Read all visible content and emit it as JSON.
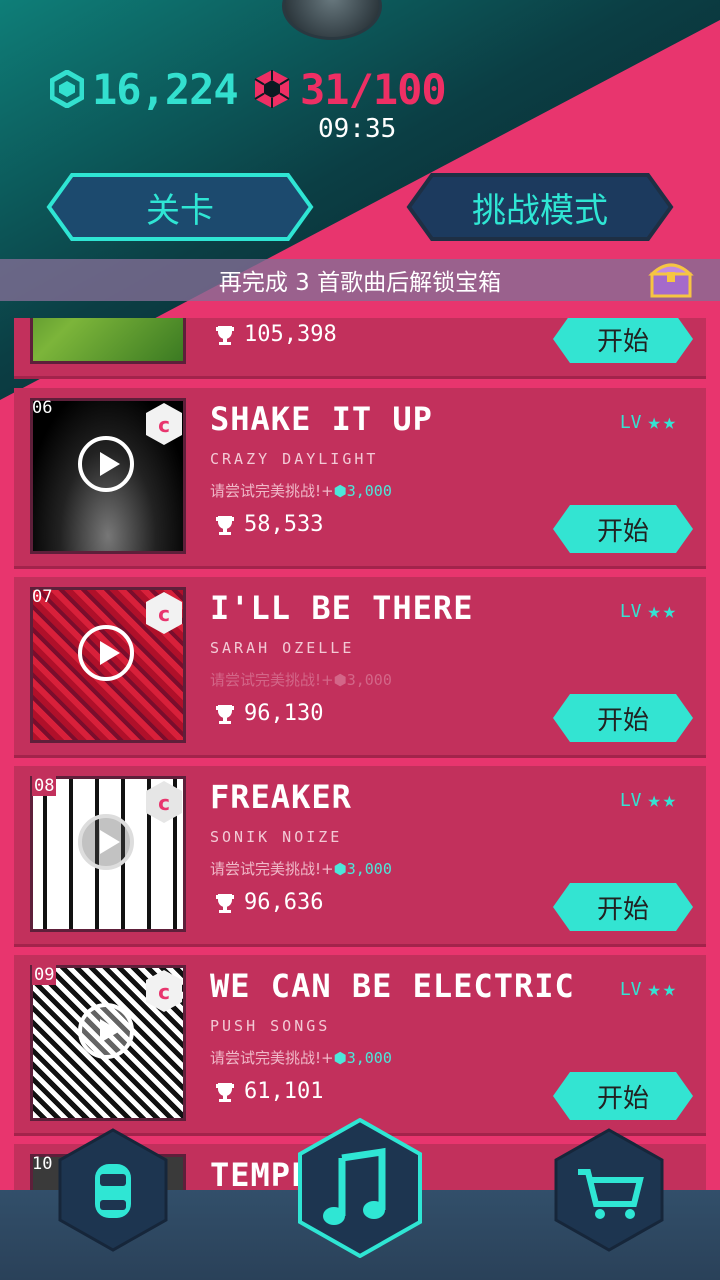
{
  "header": {
    "coins": "16,224",
    "energy": "31/100",
    "timer": "09:35"
  },
  "tabs": [
    {
      "label": "关卡"
    },
    {
      "label": "挑战模式"
    }
  ],
  "banner": "再完成 3 首歌曲后解锁宝箱",
  "songs": [
    {
      "number": "",
      "title": "",
      "artist": "",
      "hint": "",
      "reward": "",
      "score": "105,398",
      "level_label": "",
      "start_label": "开始"
    },
    {
      "number": "06",
      "title": "SHAKE IT UP",
      "artist": "CRAZY DAYLIGHT",
      "hint": "请尝试完美挑战!+",
      "reward": "3,000",
      "score": "58,533",
      "level_label": "LV",
      "start_label": "开始"
    },
    {
      "number": "07",
      "title": "I'LL BE THERE",
      "artist": "SARAH OZELLE",
      "hint": "请尝试完美挑战!+",
      "reward": "3,000",
      "score": "96,130",
      "level_label": "LV",
      "start_label": "开始"
    },
    {
      "number": "08",
      "title": "FREAKER",
      "artist": "SONIK NOIZE",
      "hint": "请尝试完美挑战!+",
      "reward": "3,000",
      "score": "96,636",
      "level_label": "LV",
      "start_label": "开始"
    },
    {
      "number": "09",
      "title": "WE CAN BE ELECTRIC",
      "artist": "PUSH SONGS",
      "hint": "请尝试完美挑战!+",
      "reward": "3,000",
      "score": "61,101",
      "level_label": "LV",
      "start_label": "开始"
    },
    {
      "number": "10",
      "title": "TEMPER",
      "artist": "",
      "hint": "",
      "reward": "",
      "score": "",
      "level_label": "",
      "start_label": ""
    }
  ],
  "nav": [
    {
      "icon": "car-icon"
    },
    {
      "icon": "music-note-icon"
    },
    {
      "icon": "cart-icon"
    }
  ],
  "colors": {
    "accent_cyan": "#2fe6d4",
    "accent_pink": "#e8356e",
    "header_dark": "#0c1a22"
  }
}
